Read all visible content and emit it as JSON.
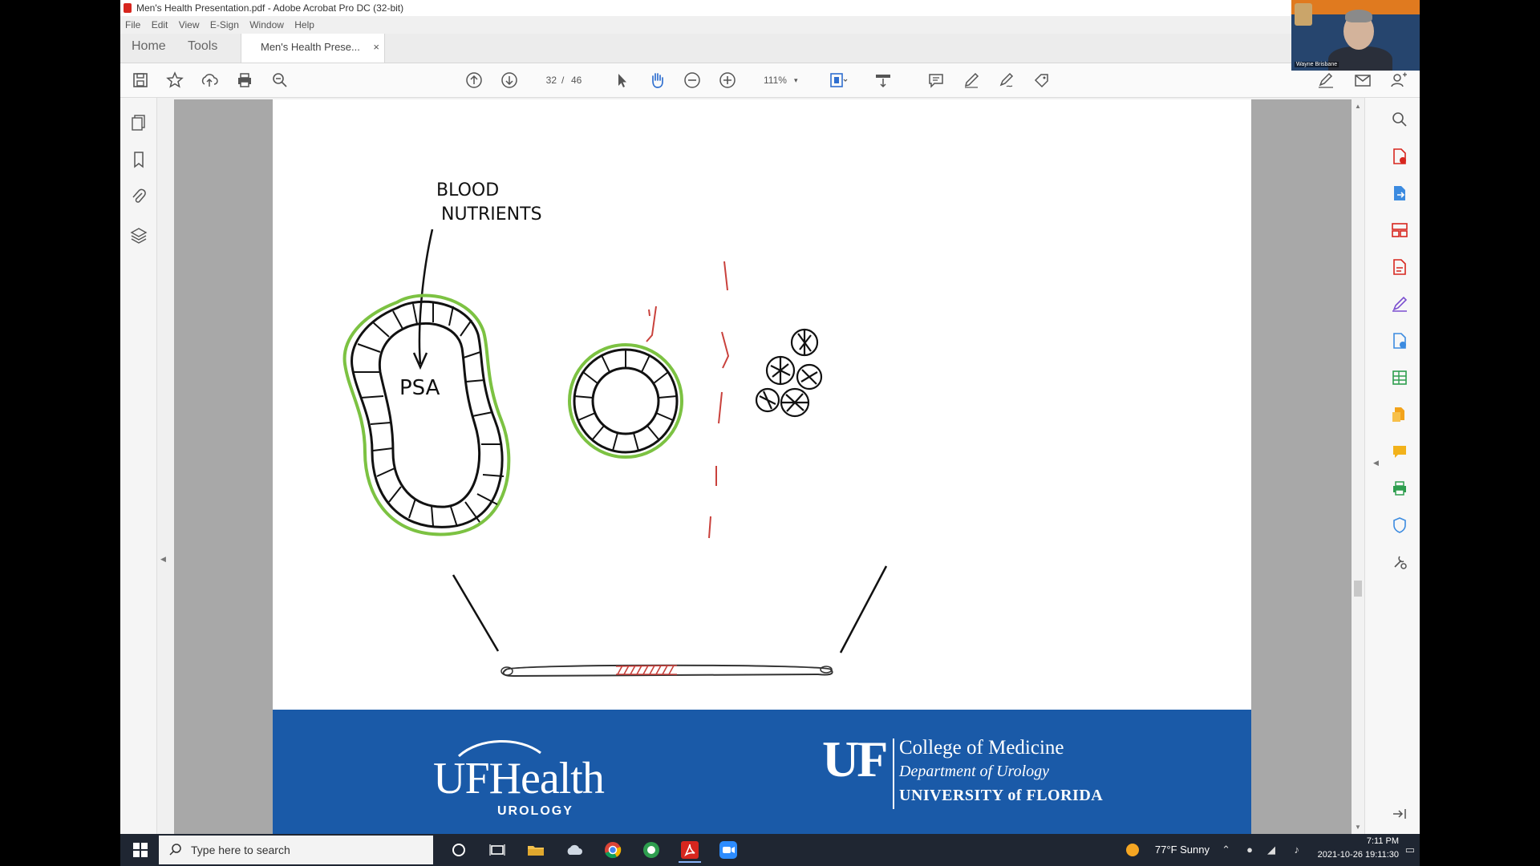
{
  "window": {
    "title": "Men's Health Presentation.pdf - Adobe Acrobat Pro DC (32-bit)"
  },
  "menu": [
    "File",
    "Edit",
    "View",
    "E-Sign",
    "Window",
    "Help"
  ],
  "tabs": {
    "home": "Home",
    "tools": "Tools",
    "document": "Men's Health Prese...",
    "close": "×"
  },
  "toolbar": {
    "page_current": "32",
    "page_sep": "/",
    "page_total": "46",
    "zoom": "111%",
    "zoom_caret": "▾"
  },
  "drawing": {
    "annotation_line1": "BLOOD",
    "annotation_line2": "NUTRIENTS",
    "gland_label": "PSA"
  },
  "footer": {
    "logo_wordmark": "UFHealth",
    "logo_department": "UROLOGY",
    "uf_mark": "UF",
    "college": "College of Medicine",
    "department": "Department of Urology",
    "university": "UNIVERSITY of FLORIDA"
  },
  "webcam": {
    "name": "Wayne Brisbane"
  },
  "taskbar": {
    "search_placeholder": "Type here to search",
    "weather": "77°F  Sunny",
    "time": "7:11 PM",
    "date": "2021-10-26 19:11:30"
  },
  "colors": {
    "accent_blue": "#1a5aa8",
    "gland_outline": "#7cc242",
    "red_marks": "#c9413c",
    "acrobat_red": "#d7261e"
  },
  "icons": {
    "toolbar": [
      "save-icon",
      "star-icon",
      "cloud-upload-icon",
      "print-icon",
      "zoom-out-search-icon",
      "prev-page-icon",
      "next-page-icon",
      "select-cursor-icon",
      "hand-icon",
      "zoom-minus-icon",
      "zoom-plus-icon",
      "fit-page-icon",
      "scroll-mode-icon",
      "comment-icon",
      "pen-icon",
      "sign-icon",
      "stamp-icon",
      "sign-request-icon",
      "email-icon",
      "share-user-icon"
    ],
    "left": [
      "page-thumbnails-icon",
      "bookmark-icon",
      "attachment-icon",
      "layers-icon"
    ],
    "right": [
      "search-icon",
      "export-pdf-icon",
      "create-pdf-icon",
      "organize-pages-icon",
      "edit-pdf-icon",
      "fill-sign-icon",
      "request-signature-icon",
      "export-excel-icon",
      "combine-files-icon",
      "comment-tool-icon",
      "print-production-icon",
      "protect-icon",
      "more-tools-icon",
      "right-pane-collapse-icon"
    ]
  }
}
